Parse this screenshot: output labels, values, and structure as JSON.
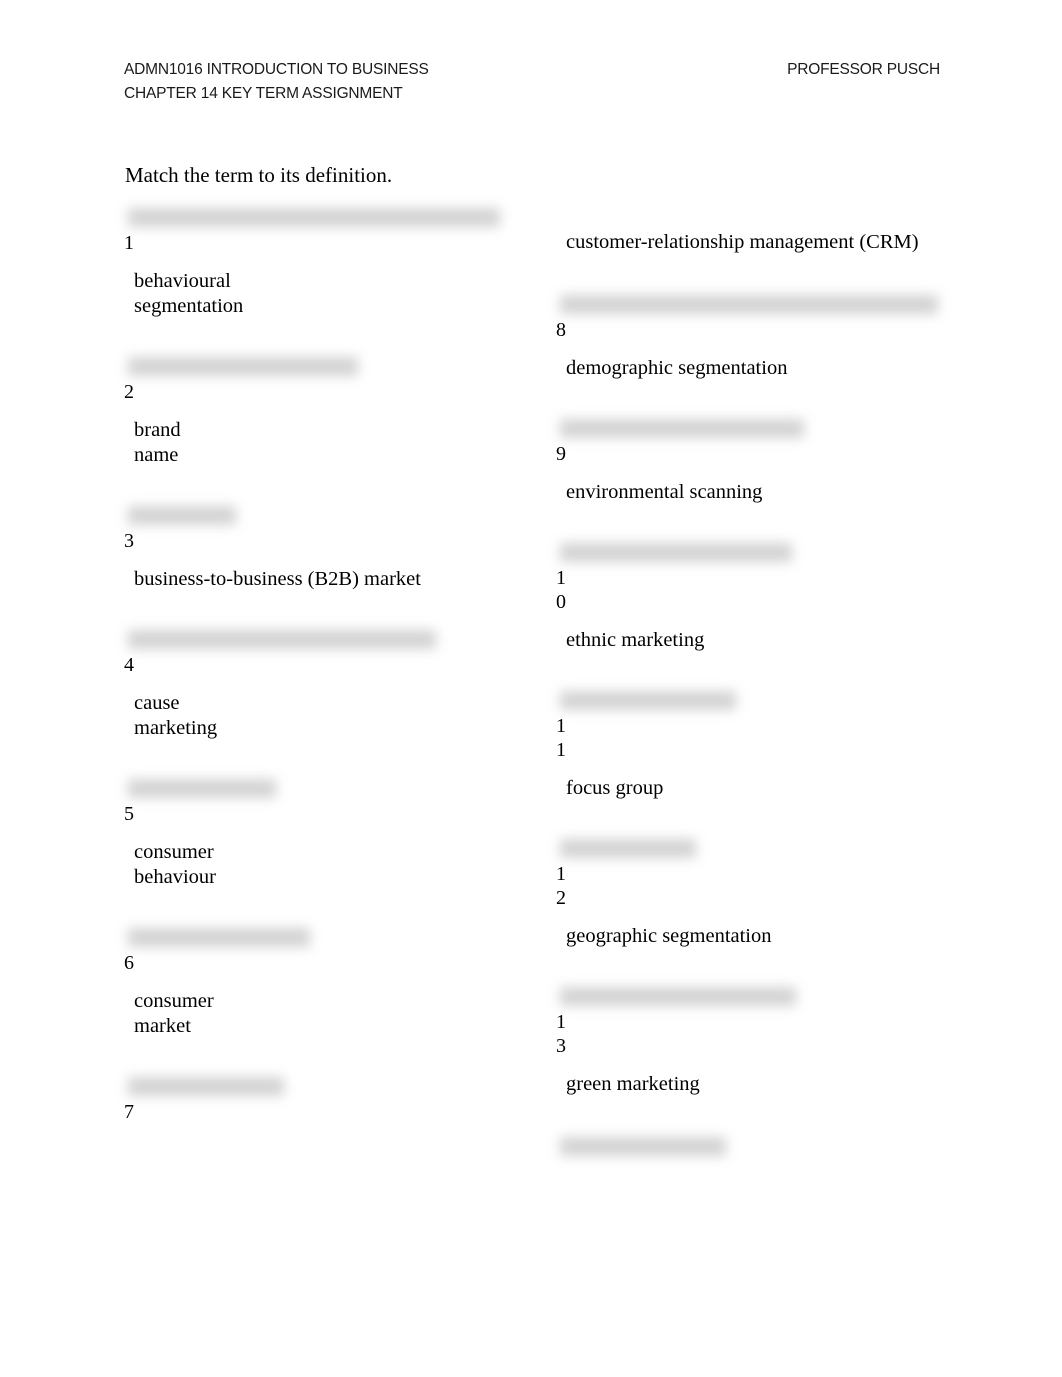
{
  "header": {
    "line1": "ADMN1016 INTRODUCTION TO BUSINESS",
    "line2": "CHAPTER 14 KEY TERM ASSIGNMENT",
    "right": "PROFESSOR PUSCH"
  },
  "instruction": "Match the term to its definition.",
  "colors": {
    "page_background": "#ffffff",
    "text": "#000000",
    "header_text": "#1a1a1a",
    "redaction_bar": "#cfcfcf"
  },
  "left_column": [
    {
      "number": "1",
      "term": "behavioural\nsegmentation",
      "redaction_width": 372,
      "gap_before": 0
    },
    {
      "number": "2",
      "term": "brand\nname",
      "redaction_width": 230,
      "gap_before": 38
    },
    {
      "number": "3",
      "term": "business-to-business (B2B) market",
      "redaction_width": 108,
      "gap_before": 38
    },
    {
      "number": "4",
      "term": "cause\nmarketing",
      "redaction_width": 308,
      "gap_before": 38
    },
    {
      "number": "5",
      "term": "consumer\nbehaviour",
      "redaction_width": 148,
      "gap_before": 38
    },
    {
      "number": "6",
      "term": "consumer\nmarket",
      "redaction_width": 182,
      "gap_before": 38
    },
    {
      "number": "7",
      "term": "",
      "redaction_width": 156,
      "gap_before": 38
    }
  ],
  "right_column": [
    {
      "number": "",
      "term": "customer-relationship management (CRM)",
      "redaction_width": 0,
      "gap_before": 22,
      "lead": true
    },
    {
      "number": "8",
      "term": "demographic segmentation",
      "redaction_width": 378,
      "gap_before": 40
    },
    {
      "number": "9",
      "term": "environmental scanning",
      "redaction_width": 244,
      "gap_before": 38
    },
    {
      "number": "10",
      "term": "ethnic marketing",
      "redaction_width": 232,
      "gap_before": 38
    },
    {
      "number": "11",
      "term": "focus group",
      "redaction_width": 176,
      "gap_before": 38
    },
    {
      "number": "12",
      "term": "geographic segmentation",
      "redaction_width": 136,
      "gap_before": 38
    },
    {
      "number": "13",
      "term": "green marketing",
      "redaction_width": 236,
      "gap_before": 38
    },
    {
      "number": "",
      "term": "",
      "redaction_width": 166,
      "gap_before": 40,
      "cutoff": true
    }
  ]
}
